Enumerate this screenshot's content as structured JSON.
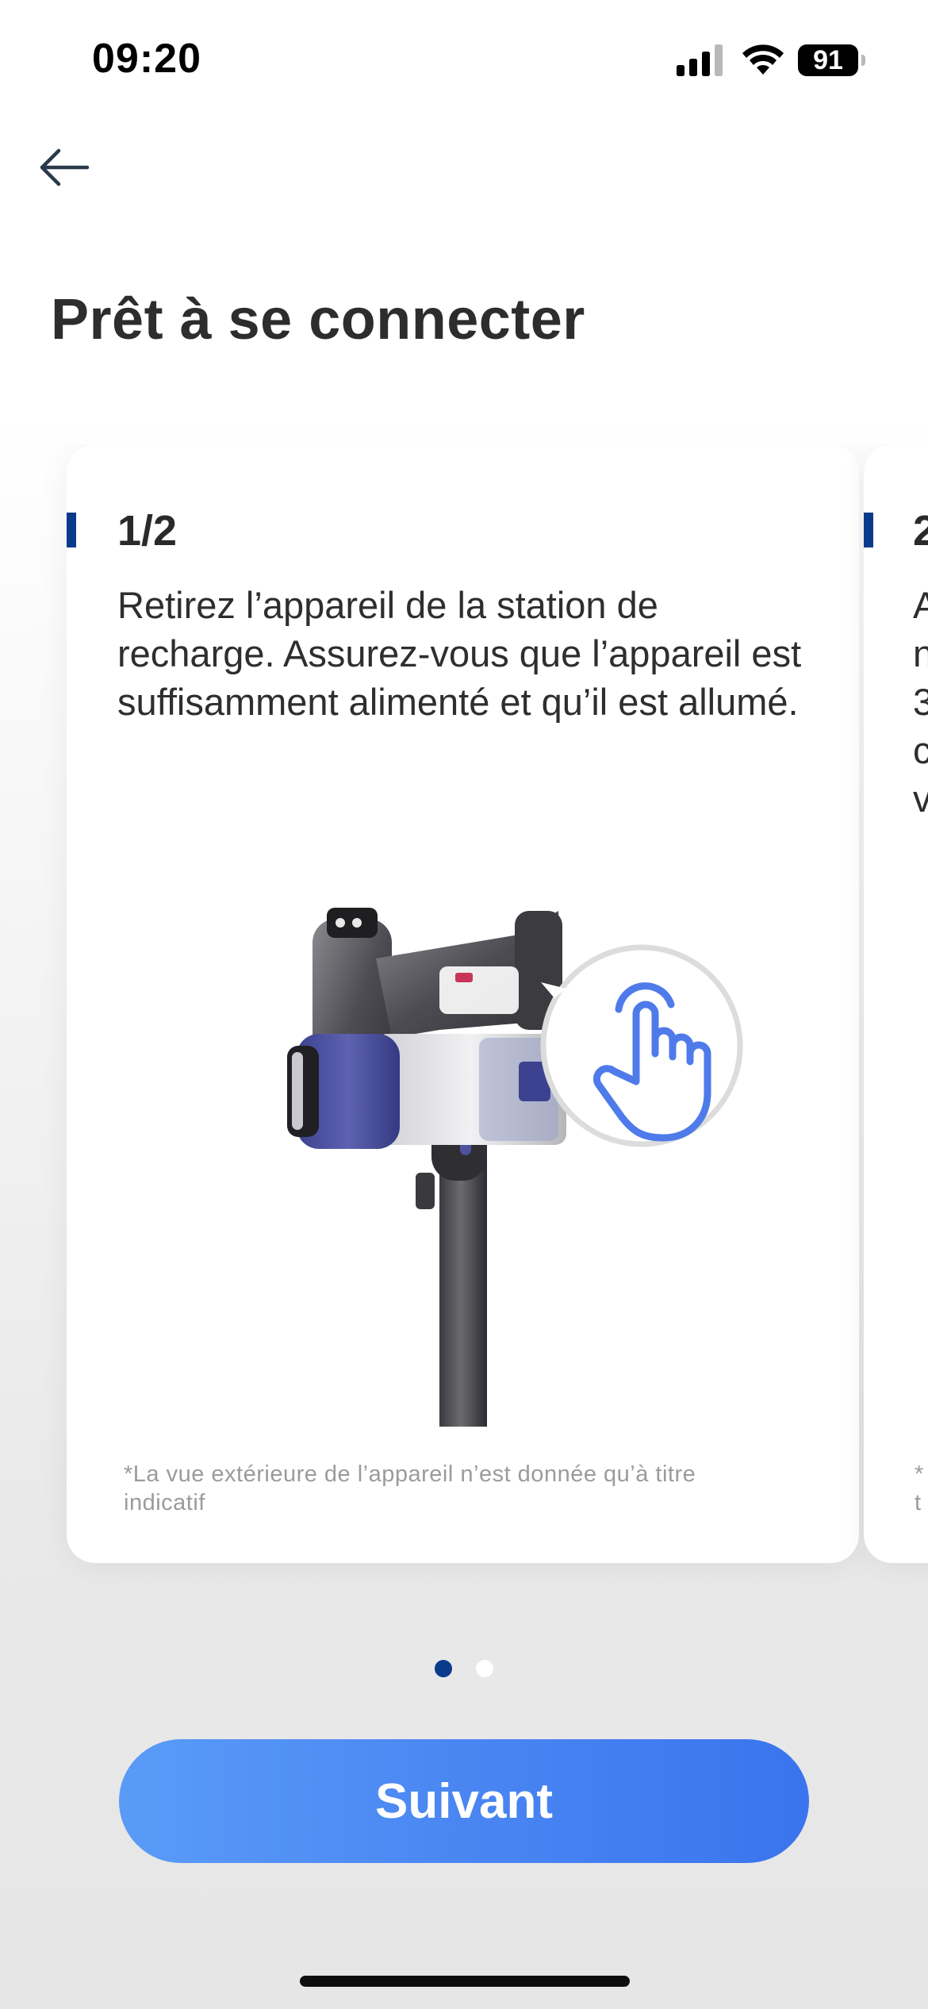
{
  "status_bar": {
    "time": "09:20",
    "battery": "91",
    "icons": [
      "signal-icon",
      "wifi-icon",
      "battery-icon"
    ]
  },
  "header": {
    "back_icon": "arrow-left-icon",
    "title": "Prêt à se connecter"
  },
  "carousel": {
    "cards": [
      {
        "step": "1/2",
        "text": "Retirez l’appareil de la station de recharge. Assurez-vous que l’appareil est suffisamment alimenté et qu’il est allumé.",
        "disclaimer": "*La vue extérieure de l’appareil n’est donnée qu’à titre indicatif",
        "illustration": "stick-vacuum-with-tap-hand-icon"
      },
      {
        "step": "2",
        "text": "A\nn\n3\nc\nv",
        "disclaimer": "*\nt"
      }
    ],
    "active_index": 0,
    "total": 2
  },
  "footer": {
    "next_label": "Suivant"
  },
  "colors": {
    "accent_blue": "#4a86f2",
    "marker_navy": "#0a3a8c",
    "hand_icon_blue": "#4f7bea"
  }
}
